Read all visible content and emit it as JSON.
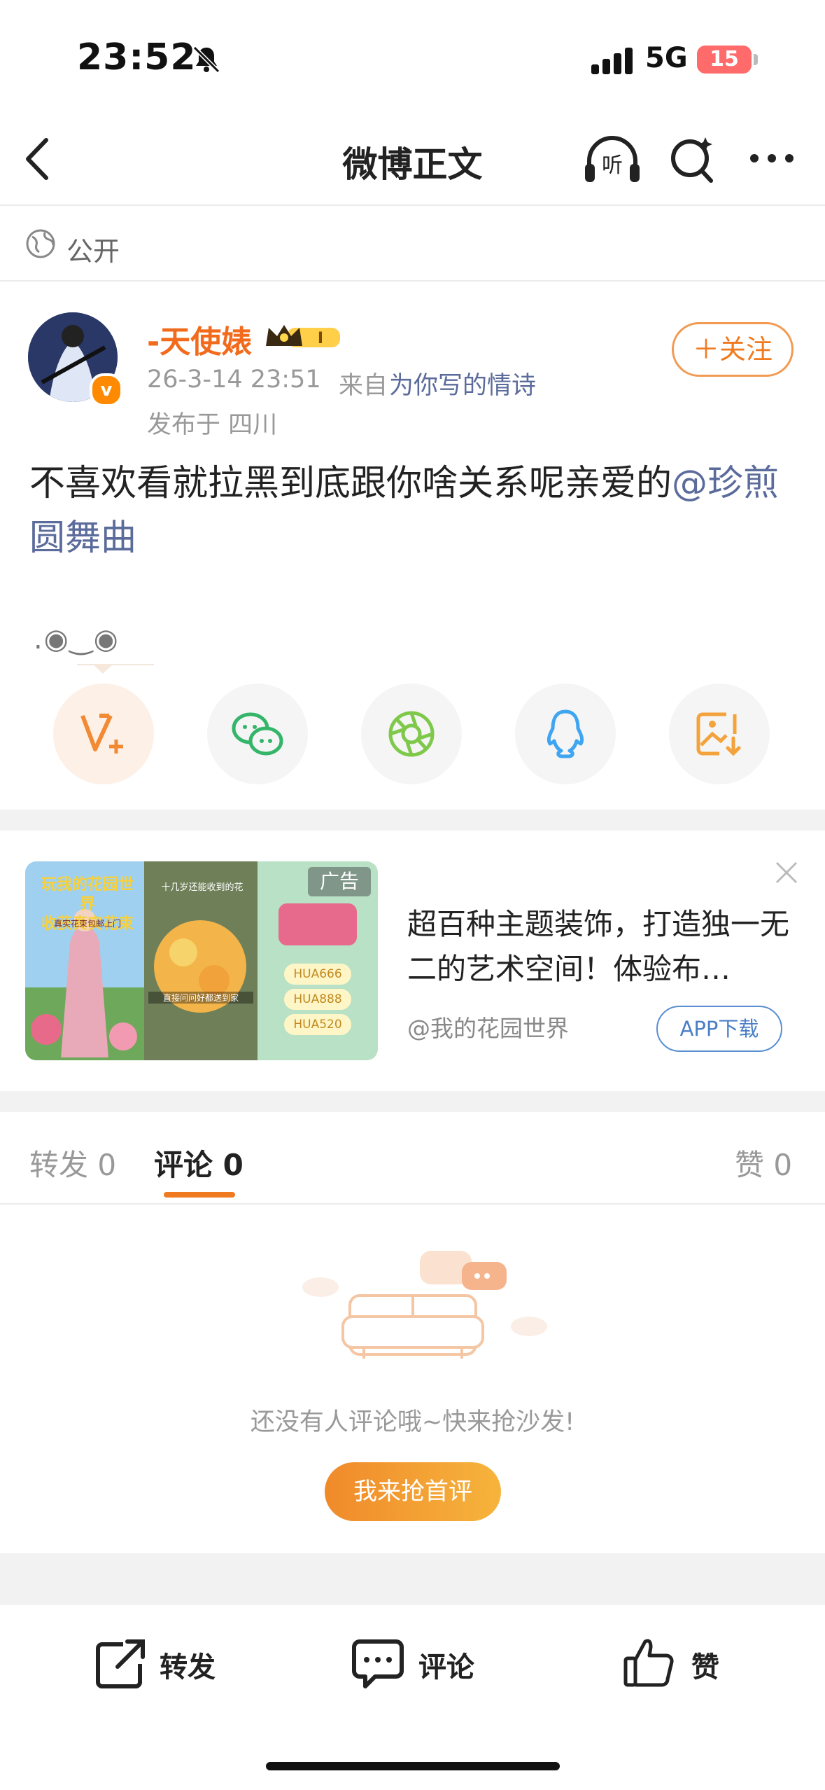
{
  "status_bar": {
    "time": "23:52",
    "network": "5G",
    "battery": "15"
  },
  "nav": {
    "title": "微博正文"
  },
  "visibility": {
    "label": "公开"
  },
  "post": {
    "username": "-天使婊",
    "time": "26-3-14 23:51",
    "source_prefix": "来自",
    "source": "为你写的情诗",
    "location": "发布于 四川",
    "follow_label": "＋关注",
    "text": "不喜欢看就拉黑到底跟你啥关系呢亲爱的",
    "mention": "@珍煎圆舞曲",
    "emoji": ".◉‿◉"
  },
  "share": {
    "items": [
      "vplus-icon",
      "wechat-icon",
      "moments-icon",
      "qq-icon",
      "save-image-icon"
    ]
  },
  "ad": {
    "tag": "广告",
    "title": "超百种主题装饰，打造独一无二的艺术空间！体验布…",
    "author": "@我的花园世界",
    "download_label": "APP下载",
    "image_text_1": "玩我的花园世界",
    "image_text_2": "收获真实花束",
    "image_text_3": "真实花束包邮上门",
    "image_text_4": "十几岁还能收到的花",
    "image_text_5": "直接问问好都送到家",
    "codes": [
      "HUA666",
      "HUA888",
      "HUA520"
    ]
  },
  "tabs": {
    "repost_label": "转发",
    "repost_count": "0",
    "comment_label": "评论",
    "comment_count": "0",
    "like_label": "赞",
    "like_count": "0"
  },
  "empty": {
    "text": "还没有人评论哦~快来抢沙发!",
    "button_label": "我来抢首评"
  },
  "bottom_bar": {
    "repost": "转发",
    "comment": "评论",
    "like": "赞"
  },
  "colors": {
    "accent": "#f07a20",
    "link": "#5b6b9b",
    "username": "#f26b1d"
  }
}
